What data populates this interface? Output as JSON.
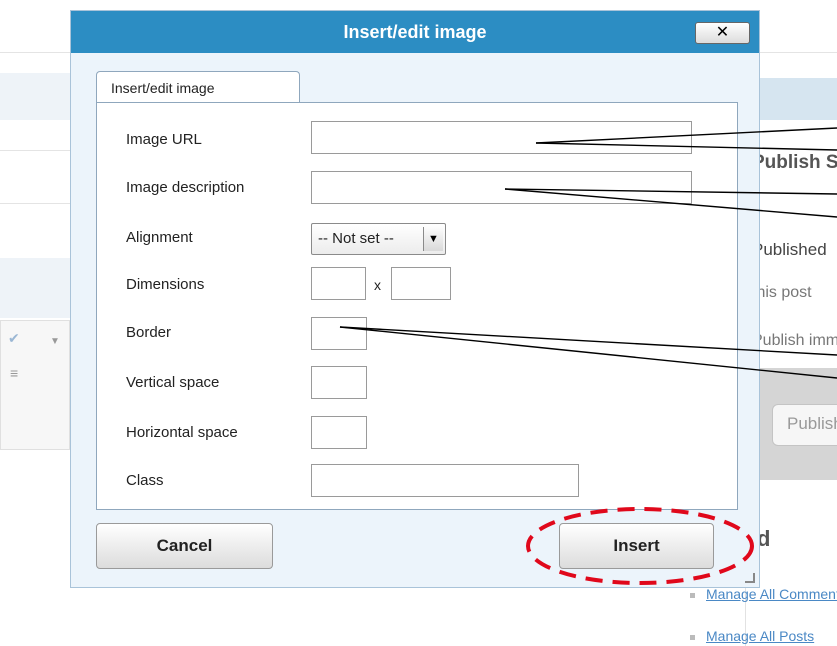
{
  "dialog": {
    "title": "Insert/edit image",
    "close_label": "✕",
    "tab_label": "Insert/edit image",
    "fields": {
      "image_url": {
        "label": "Image URL",
        "value": ""
      },
      "image_description": {
        "label": "Image description",
        "value": ""
      },
      "alignment": {
        "label": "Alignment",
        "selected": "-- Not set --"
      },
      "dimensions": {
        "label": "Dimensions",
        "separator": "x",
        "width": "",
        "height": ""
      },
      "border": {
        "label": "Border",
        "value": ""
      },
      "vertical_space": {
        "label": "Vertical space",
        "value": ""
      },
      "horizontal_space": {
        "label": "Horizontal space",
        "value": ""
      },
      "class": {
        "label": "Class",
        "value": ""
      }
    },
    "buttons": {
      "cancel": "Cancel",
      "insert": "Insert"
    }
  },
  "background": {
    "publish_status": "Publish Status",
    "published": "Published",
    "this_post": "this post",
    "publish_immediately": "Publish immediately",
    "publish_button": "Publish",
    "heading_fragment": "d",
    "links": [
      "Manage All Comments",
      "Manage All Posts"
    ]
  },
  "colors": {
    "titlebar": "#2c8dc3",
    "annotation_circle": "#e0081b",
    "link": "#4a88c5"
  }
}
